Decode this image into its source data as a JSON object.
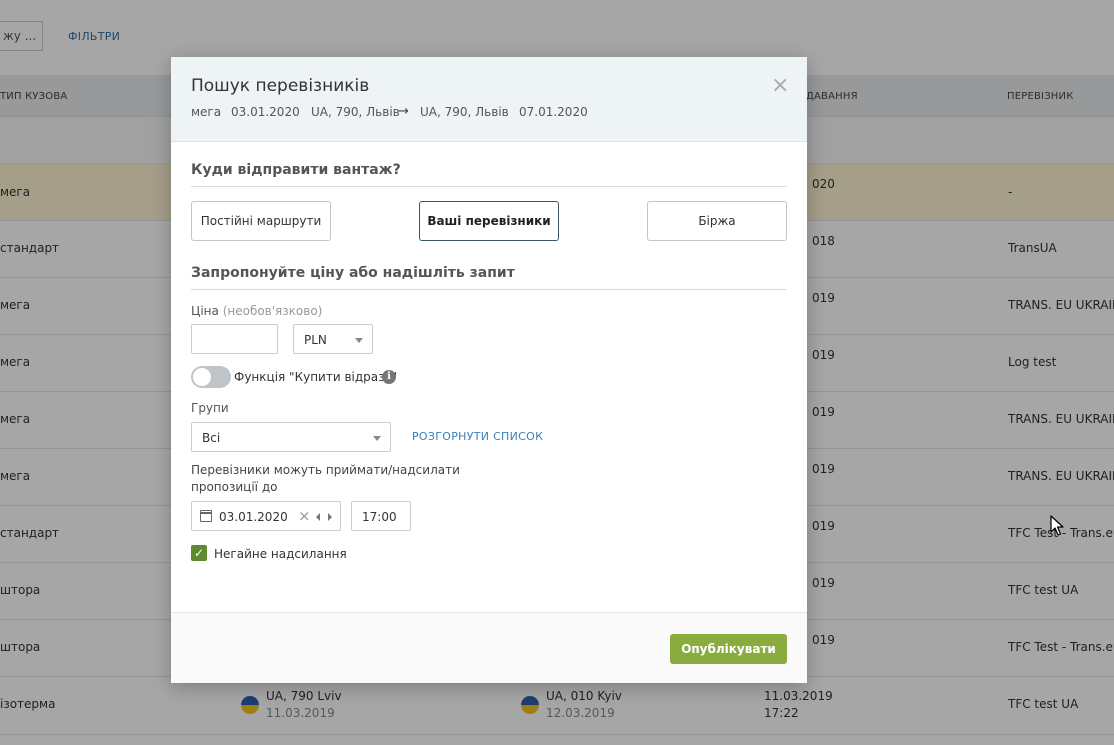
{
  "background": {
    "search_placeholder": "жу ...",
    "filters_link": "ФІЛЬТРИ",
    "columns": {
      "body_type": "ТИП КУЗОВА",
      "loading": "ДАВАННЯ",
      "carrier": "ПЕРЕВІЗНИК"
    },
    "rows": [
      {
        "body_type": "мега",
        "date": "020",
        "carrier": "-"
      },
      {
        "body_type": "стандарт",
        "date": "018",
        "carrier": "TransUA"
      },
      {
        "body_type": "мега",
        "date": "019",
        "carrier": "TRANS. EU UKRAINE"
      },
      {
        "body_type": "мега",
        "date": "019",
        "carrier": "Log test"
      },
      {
        "body_type": "мега",
        "date": "019",
        "carrier": "TRANS. EU UKRAINE"
      },
      {
        "body_type": "мега",
        "date": "019",
        "carrier": "TRANS. EU UKRAINE"
      },
      {
        "body_type": "стандарт",
        "date": "019",
        "carrier": "TFC Test - Trans.eu"
      },
      {
        "body_type": "штора",
        "date": "019",
        "carrier": "TFC test UA"
      },
      {
        "body_type": "штора",
        "date": "019",
        "carrier": "TFC Test - Trans.eu"
      }
    ],
    "last_row": {
      "body_type": "ізотерма",
      "from_place": "UA, 790 Lviv",
      "from_date": "11.03.2019",
      "to_place": "UA, 010 Kyiv",
      "to_date": "12.03.2019",
      "date": "11.03.2019",
      "time": "17:22",
      "carrier": "TFC test UA"
    }
  },
  "modal": {
    "title": "Пошук перевізників",
    "close_glyph": "×",
    "info": {
      "body": "мега",
      "date_from": "03.01.2020",
      "origin": "UA, 790, Львів",
      "arrow": "→",
      "destination": "UA, 790, Львів",
      "date_to": "07.01.2020"
    },
    "section_send": {
      "title": "Куди відправити вантаж?",
      "options": [
        "Постійні маршрути",
        "Ваші перевізники",
        "Біржа"
      ],
      "active_index": 1
    },
    "section_offer": {
      "title": "Запропонуйте ціну або надішліть запит"
    },
    "price": {
      "label": "Ціна",
      "label_hint": "(необов'язково)",
      "value": "",
      "currency": "PLN"
    },
    "buy_now": {
      "label": "Функція \"Купити відразу\"",
      "enabled": false,
      "info_glyph": "i"
    },
    "groups": {
      "label": "Групи",
      "value": "Всі",
      "expand_link": "РОЗГОРНУТИ СПИСОК"
    },
    "deadline": {
      "label_line1": "Перевізники можуть приймати/надсилати",
      "label_line2": "пропозиції до",
      "date": "03.01.2020",
      "clear_glyph": "×",
      "time": "17:00"
    },
    "immediate": {
      "label": "Негайне надсилання",
      "checked": true,
      "check_glyph": "✓"
    },
    "publish_label": "Опублікувати"
  },
  "colors": {
    "publish": "#8aac3f",
    "checkbox": "#5f8a2d",
    "link": "#3a7fb8",
    "highlight_row": "#fdf3d3"
  }
}
